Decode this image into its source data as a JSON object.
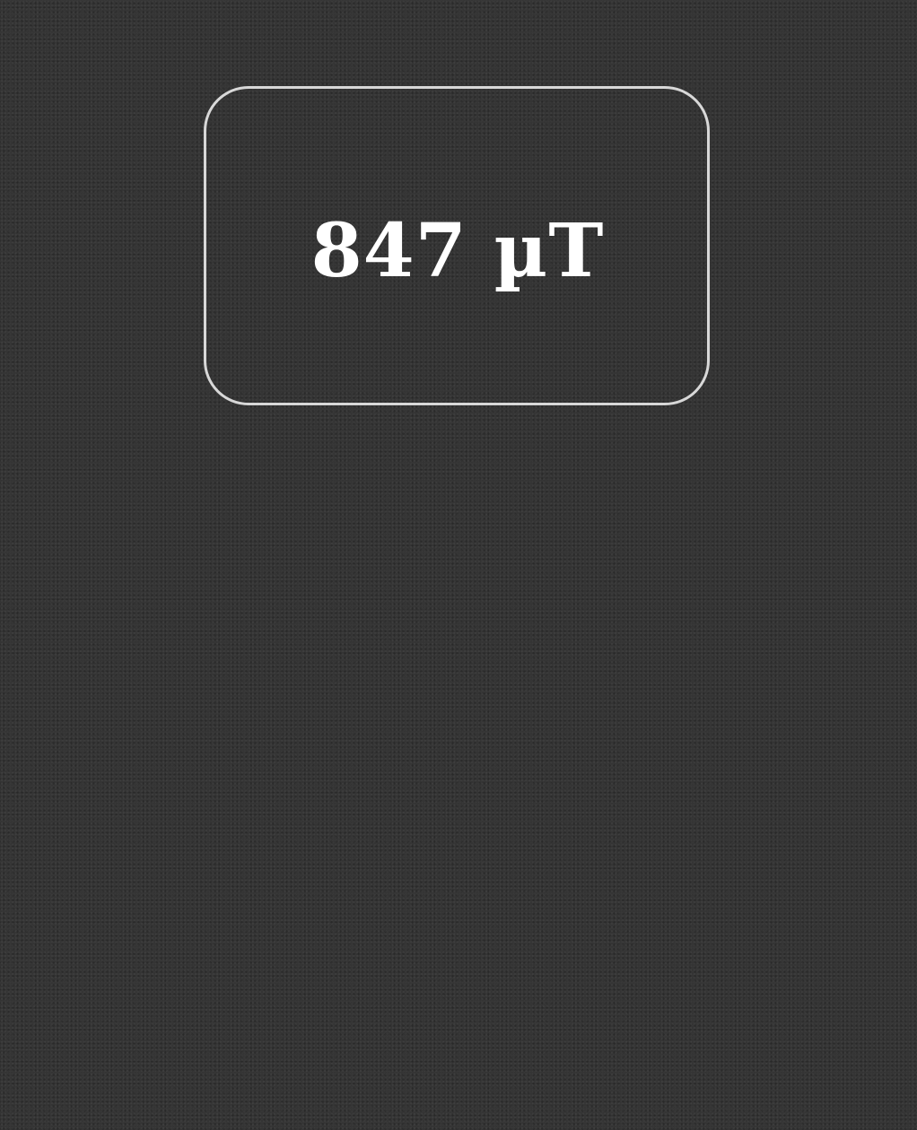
{
  "reading": {
    "value": "847 µT"
  },
  "colors": {
    "background": "#333333",
    "card_border": "#d8d8d8",
    "text": "#ffffff"
  }
}
